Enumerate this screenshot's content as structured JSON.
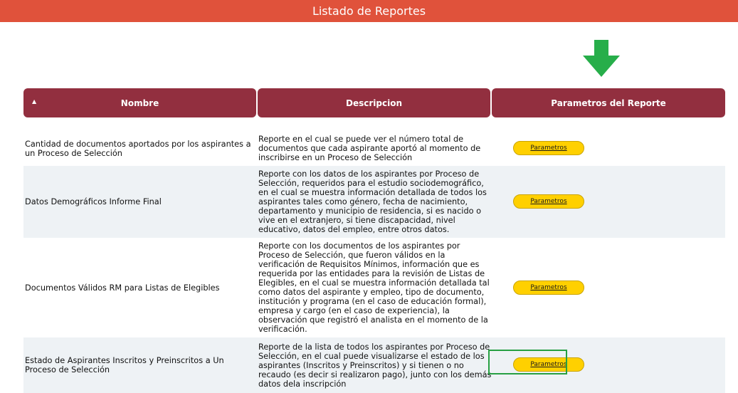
{
  "page": {
    "title": "Listado de Reportes"
  },
  "colors": {
    "topbar": "#e0523b",
    "header": "#922f3f",
    "button": "#ffd000",
    "arrow": "#27ae4a",
    "highlight": "#27a043"
  },
  "icons": {
    "arrow": "down-arrow-icon",
    "sort": "sort-ascending-icon"
  },
  "table": {
    "sort_indicator": "▲",
    "headers": {
      "name": "Nombre",
      "description": "Descripcion",
      "params": "Parametros del Reporte"
    },
    "rows": [
      {
        "name": "Cantidad de documentos aportados por los aspirantes a un Proceso de Selección",
        "description": "Reporte en el cual se puede ver el número total de documentos que cada aspirante aportó al momento de inscribirse en un Proceso de Selección",
        "button": "Parametros"
      },
      {
        "name": "Datos Demográficos Informe Final",
        "description": "Reporte con los datos de los aspirantes por Proceso de Selección, requeridos para el estudio sociodemográfico, en el cual se muestra información detallada de todos los aspirantes tales como género, fecha de nacimiento, departamento y municipio de residencia, si es nacido o vive en el extranjero, si tiene discapacidad, nivel educativo, datos del empleo, entre otros datos.",
        "button": "Parametros"
      },
      {
        "name": "Documentos Válidos RM para Listas de Elegibles",
        "description": "Reporte con los documentos de los aspirantes por Proceso de Selección, que fueron válidos en la verificación de Requisitos Mínimos, información que es requerida por las entidades para la revisión de Listas de Elegibles, en el cual se muestra información detallada tal como datos del aspirante y empleo, tipo de documento, institución y programa (en el caso de educación formal), empresa y cargo (en el caso de experiencia), la observación que registró el analista en el momento de la verificación.",
        "button": "Parametros"
      },
      {
        "name": "Estado de Aspirantes Inscritos y Preinscritos a Un Proceso de Selección",
        "description": "Reporte de la lista de todos los aspirantes por Proceso de Selección, en el cual puede visualizarse el estado de los aspirantes (Inscritos y Preinscritos) y si tienen o no recaudo (es decir si realizaron pago), junto con los demás datos dela inscripción",
        "button": "Parametros"
      }
    ]
  }
}
